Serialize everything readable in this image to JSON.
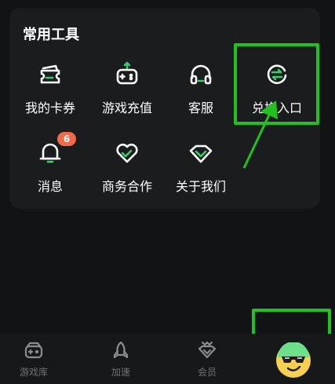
{
  "section": {
    "title": "常用工具"
  },
  "tools": [
    {
      "label": "我的卡券",
      "icon": "coupon-icon"
    },
    {
      "label": "游戏充值",
      "icon": "gamepad-recharge-icon"
    },
    {
      "label": "客服",
      "icon": "headset-icon"
    },
    {
      "label": "兑换入口",
      "icon": "exchange-icon"
    },
    {
      "label": "消息",
      "icon": "bell-icon",
      "badge": "6"
    },
    {
      "label": "商务合作",
      "icon": "heart-handshake-icon"
    },
    {
      "label": "关于我们",
      "icon": "shield-chevron-icon"
    }
  ],
  "bottom_nav": [
    {
      "label": "游戏库",
      "icon": "game-library-icon"
    },
    {
      "label": "加速",
      "icon": "rocket-icon"
    },
    {
      "label": "会员",
      "icon": "vip-diamond-icon"
    }
  ],
  "colors": {
    "accent": "#2fd36b",
    "highlight": "#23c11f",
    "badge": "#f4694b",
    "card": "#1b1c1d",
    "background": "#121314"
  }
}
